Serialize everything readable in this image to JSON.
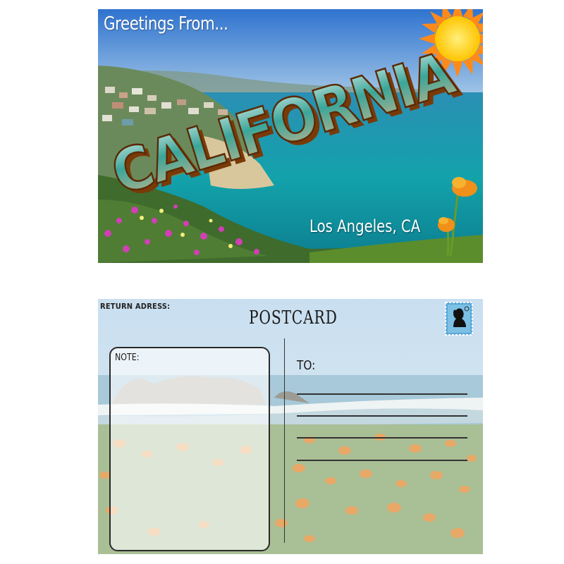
{
  "front": {
    "greeting": "Greetings From...",
    "title": "CALIFORNIA",
    "location": "Los Angeles, CA",
    "colors": {
      "sky": "#3f86d6",
      "ocean": "#1a9aa8",
      "sun": "#ffd21a",
      "letters_outline": "#7a3a08"
    }
  },
  "back": {
    "return_address_label": "RETURN ADRESS:",
    "title": "POSTCARD",
    "note_label": "NOTE:",
    "to_label": "TO:",
    "address_lines": 4,
    "stamp_icon": "stamp-silhouette-icon"
  }
}
